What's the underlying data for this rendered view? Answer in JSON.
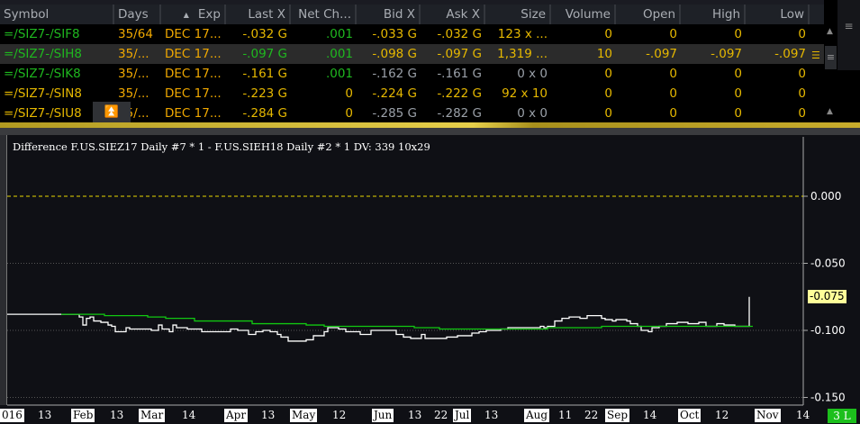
{
  "watchlist": {
    "columns": [
      "Symbol",
      "Days",
      "Exp",
      "Last X",
      "Net Ch...",
      "Bid X",
      "Ask X",
      "Size",
      "Volume",
      "Open",
      "High",
      "Low"
    ],
    "sort_indicator": "▲",
    "rows": [
      {
        "symbol": "=/SIZ7-/SIF8",
        "days": "35/64",
        "exp": "DEC 17...",
        "last": "-.032 G",
        "net": ".001",
        "bid": "-.033 G",
        "ask": "-.032 G",
        "size": "123 x ...",
        "volume": "0",
        "open": "0",
        "high": "0",
        "low": "0"
      },
      {
        "symbol": "=/SIZ7-/SIH8",
        "days": "35/...",
        "exp": "DEC 17...",
        "last": "-.097 G",
        "net": ".001",
        "bid": "-.098 G",
        "ask": "-.097 G",
        "size": "1,319 ...",
        "volume": "10",
        "open": "-.097",
        "high": "-.097",
        "low": "-.097"
      },
      {
        "symbol": "=/SIZ7-/SIK8",
        "days": "35/...",
        "exp": "DEC 17...",
        "last": "-.161 G",
        "net": ".001",
        "bid": "-.162 G",
        "ask": "-.161 G",
        "size": "0 x 0",
        "volume": "0",
        "open": "0",
        "high": "0",
        "low": "0"
      },
      {
        "symbol": "=/SIZ7-/SIN8",
        "days": "35/...",
        "exp": "DEC 17...",
        "last": "-.223 G",
        "net": "0",
        "bid": "-.224 G",
        "ask": "-.222 G",
        "size": "92 x 10",
        "volume": "0",
        "open": "0",
        "high": "0",
        "low": "0"
      },
      {
        "symbol": "=/SIZ7-/SIU8",
        "days": "35/...",
        "exp": "DEC 17...",
        "last": "-.284 G",
        "net": "0",
        "bid": "-.285 G",
        "ask": "-.282 G",
        "size": "0 x 0",
        "volume": "0",
        "open": "0",
        "high": "0",
        "low": "0"
      }
    ],
    "colors": {
      "green": "#1fb81f",
      "yellow": "#e6b800",
      "gray": "#9aa0a8"
    }
  },
  "chart": {
    "title": "Difference F.US.SIEZ17  Daily  #7 * 1 - F.US.SIEH18  Daily  #2 * 1 DV: 339 10x29",
    "last_value": "-0.075",
    "study_count": "3 L",
    "price_labels": [
      "0.000",
      "-0.050",
      "-0.100",
      "-0.150"
    ],
    "x_labels": [
      {
        "t": "016",
        "box": true
      },
      {
        "t": "13"
      },
      {
        "t": "Feb",
        "box": true
      },
      {
        "t": "13"
      },
      {
        "t": "Mar",
        "box": true
      },
      {
        "t": "14"
      },
      {
        "t": "Apr",
        "box": true
      },
      {
        "t": "13"
      },
      {
        "t": "May",
        "box": true
      },
      {
        "t": "12"
      },
      {
        "t": "Jun",
        "box": true
      },
      {
        "t": "13"
      },
      {
        "t": "22"
      },
      {
        "t": "Jul",
        "box": true
      },
      {
        "t": "13"
      },
      {
        "t": "Aug",
        "box": true
      },
      {
        "t": "11"
      },
      {
        "t": "22"
      },
      {
        "t": "Sep",
        "box": true
      },
      {
        "t": "14"
      },
      {
        "t": "Oct",
        "box": true
      },
      {
        "t": "12"
      },
      {
        "t": "Nov",
        "box": true
      },
      {
        "t": "14"
      }
    ]
  },
  "chart_data": {
    "type": "line",
    "ylim": [
      -0.155,
      0.045
    ],
    "xlim": [
      0,
      221
    ],
    "zero_line": 0.0,
    "series": [
      {
        "name": "difference",
        "color": "#ffffff",
        "points": [
          [
            0,
            -0.088
          ],
          [
            20,
            -0.09
          ],
          [
            21,
            -0.096
          ],
          [
            22,
            -0.091
          ],
          [
            23,
            -0.09
          ],
          [
            24,
            -0.093
          ],
          [
            26,
            -0.094
          ],
          [
            28,
            -0.096
          ],
          [
            29,
            -0.097
          ],
          [
            30,
            -0.101
          ],
          [
            33,
            -0.098
          ],
          [
            34,
            -0.099
          ],
          [
            40,
            -0.1
          ],
          [
            42,
            -0.096
          ],
          [
            43,
            -0.099
          ],
          [
            45,
            -0.101
          ],
          [
            46,
            -0.096
          ],
          [
            47,
            -0.098
          ],
          [
            50,
            -0.099
          ],
          [
            54,
            -0.101
          ],
          [
            62,
            -0.099
          ],
          [
            64,
            -0.1
          ],
          [
            67,
            -0.103
          ],
          [
            69,
            -0.101
          ],
          [
            71,
            -0.1
          ],
          [
            73,
            -0.101
          ],
          [
            75,
            -0.103
          ],
          [
            76,
            -0.105
          ],
          [
            78,
            -0.108
          ],
          [
            83,
            -0.107
          ],
          [
            85,
            -0.104
          ],
          [
            88,
            -0.101
          ],
          [
            89,
            -0.098
          ],
          [
            92,
            -0.099
          ],
          [
            94,
            -0.101
          ],
          [
            98,
            -0.103
          ],
          [
            101,
            -0.1
          ],
          [
            108,
            -0.103
          ],
          [
            110,
            -0.105
          ],
          [
            112,
            -0.106
          ],
          [
            115,
            -0.103
          ],
          [
            116,
            -0.106
          ],
          [
            122,
            -0.105
          ],
          [
            125,
            -0.104
          ],
          [
            129,
            -0.102
          ],
          [
            131,
            -0.101
          ],
          [
            133,
            -0.1
          ],
          [
            137,
            -0.099
          ],
          [
            139,
            -0.098
          ],
          [
            148,
            -0.097
          ],
          [
            149,
            -0.098
          ],
          [
            150,
            -0.097
          ],
          [
            152,
            -0.093
          ],
          [
            154,
            -0.091
          ],
          [
            156,
            -0.09
          ],
          [
            159,
            -0.091
          ],
          [
            161,
            -0.089
          ],
          [
            165,
            -0.091
          ],
          [
            166,
            -0.092
          ],
          [
            168,
            -0.093
          ],
          [
            169,
            -0.092
          ],
          [
            172,
            -0.093
          ],
          [
            173,
            -0.095
          ],
          [
            175,
            -0.097
          ],
          [
            176,
            -0.1
          ],
          [
            178,
            -0.101
          ],
          [
            179,
            -0.098
          ],
          [
            181,
            -0.097
          ],
          [
            183,
            -0.095
          ],
          [
            186,
            -0.094
          ],
          [
            189,
            -0.095
          ],
          [
            192,
            -0.094
          ],
          [
            194,
            -0.097
          ],
          [
            197,
            -0.095
          ],
          [
            199,
            -0.096
          ],
          [
            202,
            -0.097
          ],
          [
            206,
            -0.075
          ]
        ]
      },
      {
        "name": "average",
        "color": "#11c811",
        "points": [
          [
            15,
            -0.088
          ],
          [
            27,
            -0.089
          ],
          [
            39,
            -0.09
          ],
          [
            44,
            -0.091
          ],
          [
            52,
            -0.093
          ],
          [
            68,
            -0.095
          ],
          [
            83,
            -0.096
          ],
          [
            88,
            -0.097
          ],
          [
            113,
            -0.098
          ],
          [
            120,
            -0.099
          ],
          [
            150,
            -0.098
          ],
          [
            165,
            -0.097
          ],
          [
            207,
            -0.097
          ]
        ]
      }
    ]
  }
}
